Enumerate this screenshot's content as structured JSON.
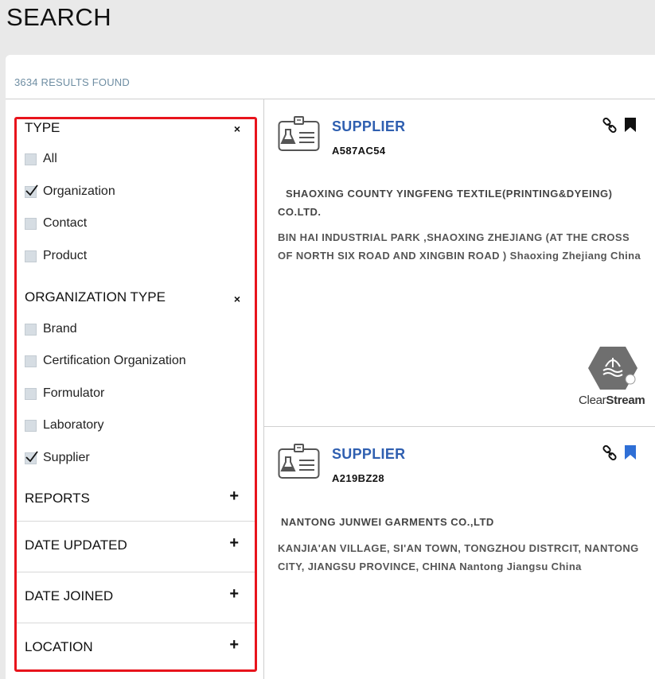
{
  "page": {
    "title": "SEARCH"
  },
  "results": {
    "count_text": "3634 RESULTS FOUND"
  },
  "filters": {
    "type": {
      "heading": "TYPE",
      "close": "×",
      "options": [
        {
          "label": "All",
          "checked": false
        },
        {
          "label": "Organization",
          "checked": true
        },
        {
          "label": "Contact",
          "checked": false
        },
        {
          "label": "Product",
          "checked": false
        }
      ]
    },
    "organization_type": {
      "heading": "ORGANIZATION TYPE",
      "close": "×",
      "options": [
        {
          "label": "Brand",
          "checked": false
        },
        {
          "label": "Certification Organization",
          "checked": false
        },
        {
          "label": "Formulator",
          "checked": false
        },
        {
          "label": "Laboratory",
          "checked": false
        },
        {
          "label": "Supplier",
          "checked": true
        }
      ]
    },
    "sections": [
      {
        "label": "REPORTS",
        "toggle": "+"
      },
      {
        "label": "DATE UPDATED",
        "toggle": "+"
      },
      {
        "label": "DATE JOINED",
        "toggle": "+"
      },
      {
        "label": "LOCATION",
        "toggle": "+"
      }
    ]
  },
  "cards": [
    {
      "type": "SUPPLIER",
      "id": "A587AC54",
      "name": "SHAOXING COUNTY YINGFENG TEXTILE(PRINTING&DYEING) CO.LTD.",
      "address": "BIN HAI INDUSTRIAL PARK ,SHAOXING ZHEJIANG (AT THE CROSS OF NORTH SIX ROAD AND XINGBIN ROAD ) Shaoxing Zhejiang China",
      "bookmark_color": "#111111",
      "badge": {
        "word_light": "Clear",
        "word_bold": "Stream"
      }
    },
    {
      "type": "SUPPLIER",
      "id": "A219BZ28",
      "name": "NANTONG JUNWEI GARMENTS CO.,LTD",
      "address": "KANJIA'AN VILLAGE, SI'AN TOWN, TONGZHOU DISTRCIT, NANTONG CITY, JIANGSU PROVINCE, CHINA Nantong Jiangsu China",
      "bookmark_color": "#2f6fd6"
    }
  ],
  "colors": {
    "accent": "#2f5fb0",
    "highlight_border": "#e8141c",
    "count_text": "#6f8ea3"
  },
  "icons": [
    "close-icon",
    "check-icon",
    "plus-icon",
    "supplier-badge-icon",
    "link-icon",
    "bookmark-icon",
    "clearstream-logo-icon"
  ]
}
